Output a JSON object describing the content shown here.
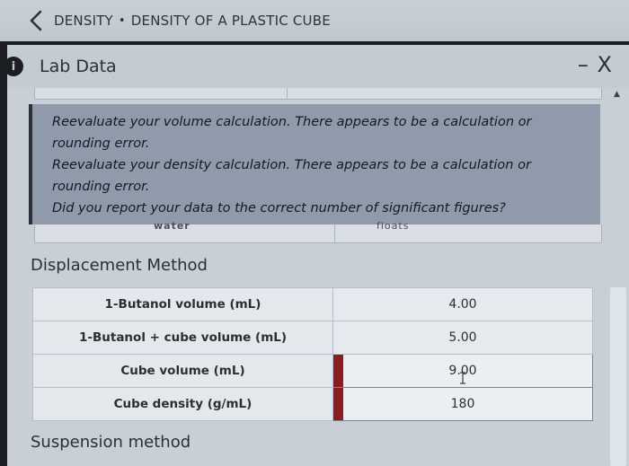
{
  "breadcrumb": {
    "part1": "DENSITY",
    "separator": "•",
    "part2": "DENSITY OF A PLASTIC CUBE"
  },
  "panel": {
    "title": "Lab Data",
    "close_label": "– X"
  },
  "feedback": {
    "line1": "Reevaluate your volume calculation. There appears to be a calculation or",
    "line2": "rounding error.",
    "line3": "Reevaluate your density calculation. There appears to be a calculation or",
    "line4": "rounding error.",
    "line5": "Did you report your data to the correct number of significant figures?"
  },
  "hidden_row": {
    "cell1": "water",
    "cell2": "floats"
  },
  "displacement": {
    "title": "Displacement Method",
    "rows": [
      {
        "label": "1-Butanol volume (mL)",
        "value": "4.00"
      },
      {
        "label": "1-Butanol + cube volume (mL)",
        "value": "5.00"
      },
      {
        "label": "Cube volume (mL)",
        "value": "9.00"
      },
      {
        "label": "Cube density (g/mL)",
        "value": "180"
      }
    ]
  },
  "suspension": {
    "title": "Suspension method"
  },
  "colors": {
    "error_flag": "#8a1c22",
    "feedback_bg": "#8f9aab"
  }
}
